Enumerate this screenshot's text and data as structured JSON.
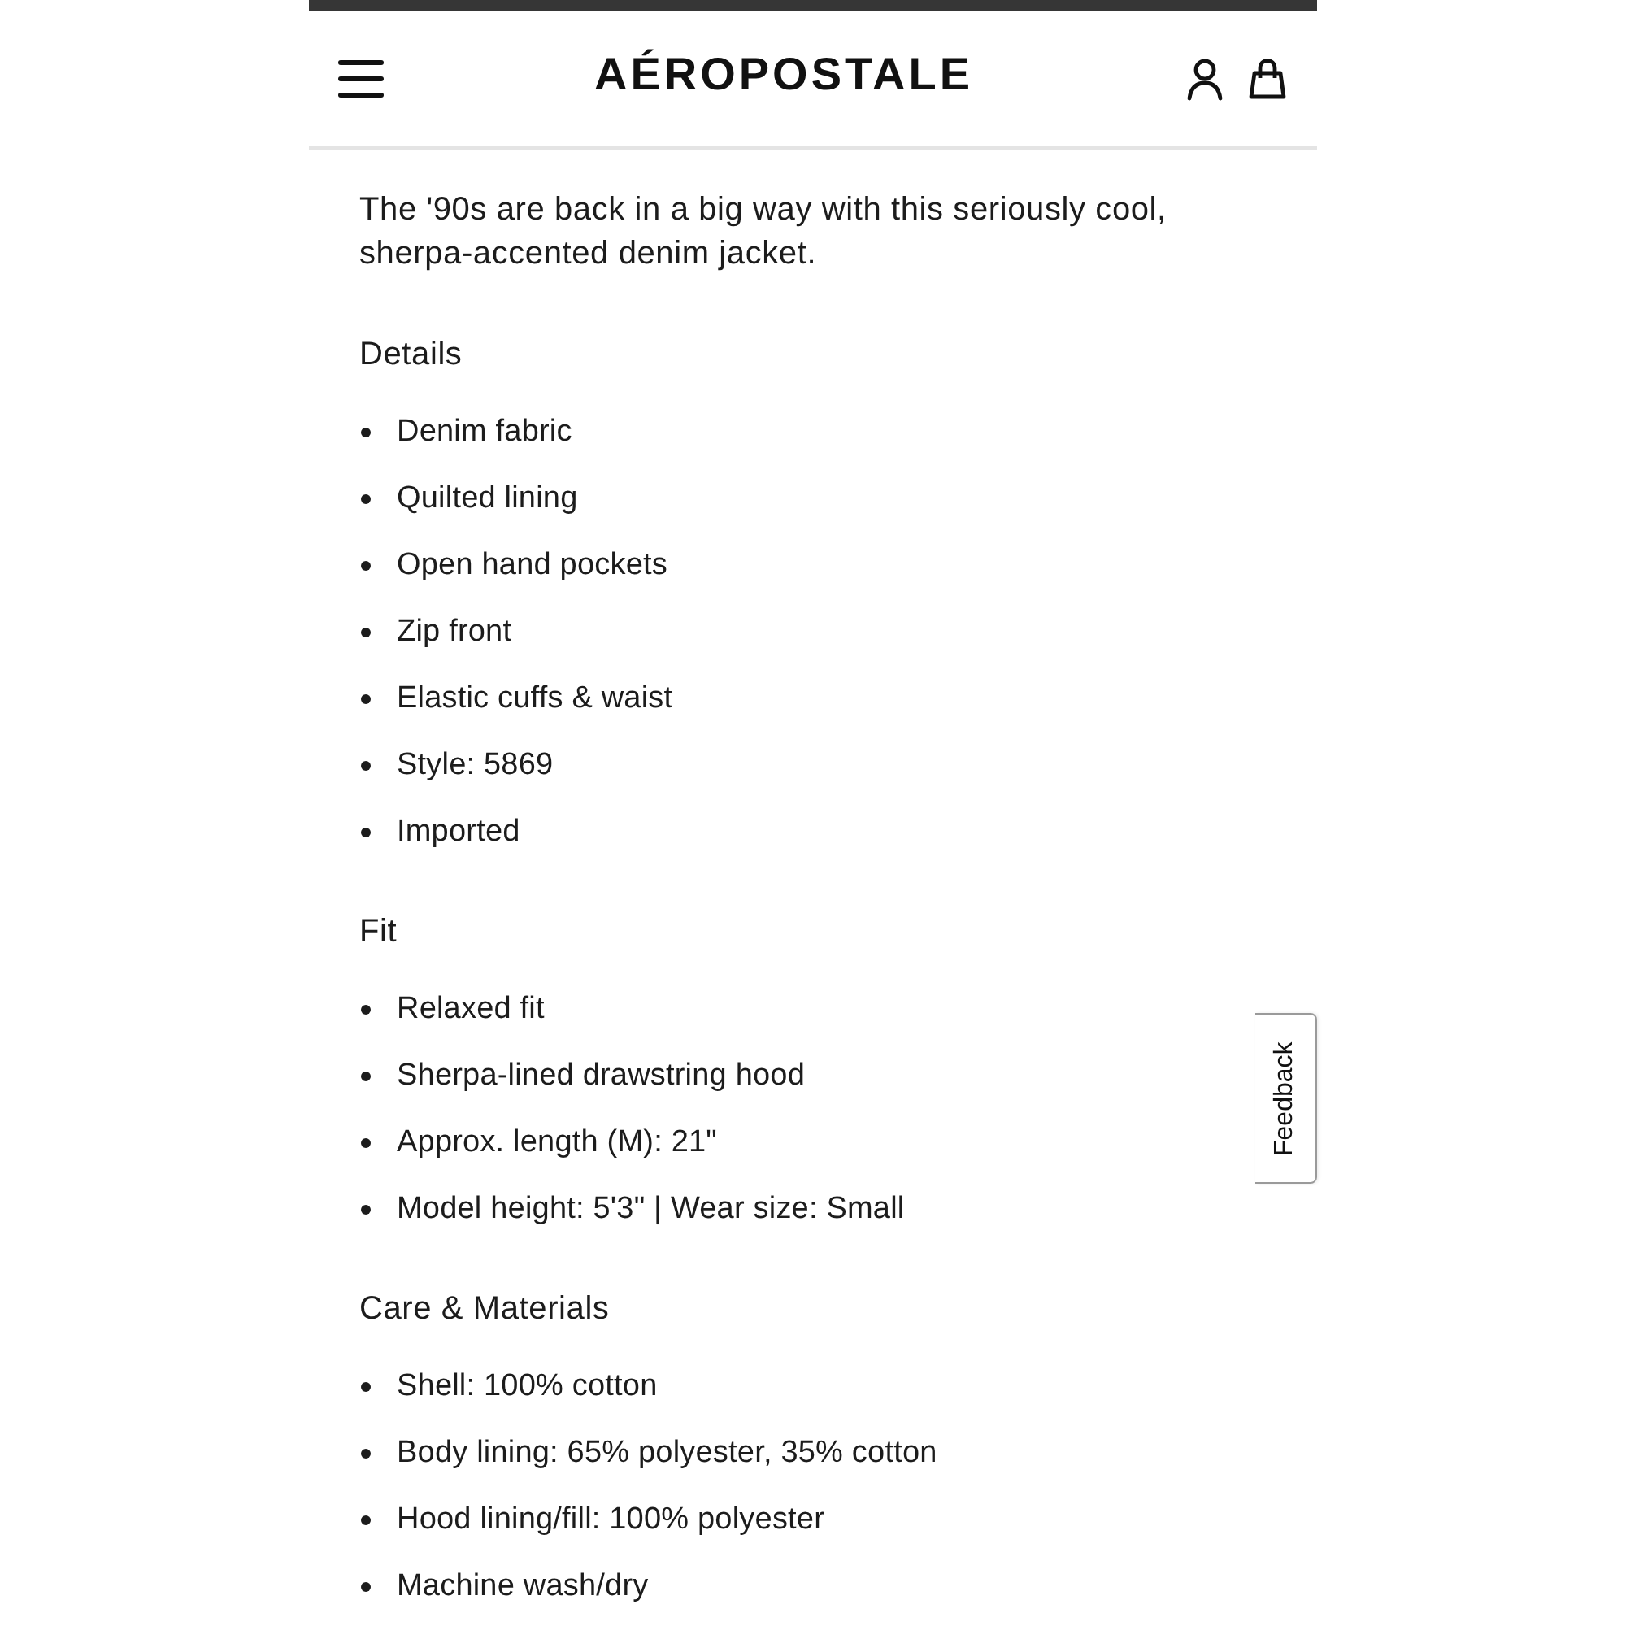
{
  "header": {
    "logo": "AÉROPOSTALE"
  },
  "description": "The '90s are back in a big way with this seriously cool, sherpa-accented denim jacket.",
  "sections": [
    {
      "heading": "Details",
      "items": [
        "Denim fabric",
        "Quilted lining",
        "Open hand pockets",
        "Zip front",
        "Elastic cuffs & waist",
        "Style: 5869",
        "Imported"
      ]
    },
    {
      "heading": "Fit",
      "items": [
        "Relaxed fit",
        "Sherpa-lined drawstring hood",
        "Approx. length (M): 21\"",
        "Model height: 5'3\" | Wear size: Small"
      ]
    },
    {
      "heading": "Care & Materials",
      "items": [
        "Shell: 100% cotton",
        "Body lining: 65% polyester, 35% cotton",
        "Hood lining/fill: 100% polyester",
        "Machine wash/dry"
      ]
    }
  ],
  "feedback_tab": {
    "label": "Feedback"
  }
}
